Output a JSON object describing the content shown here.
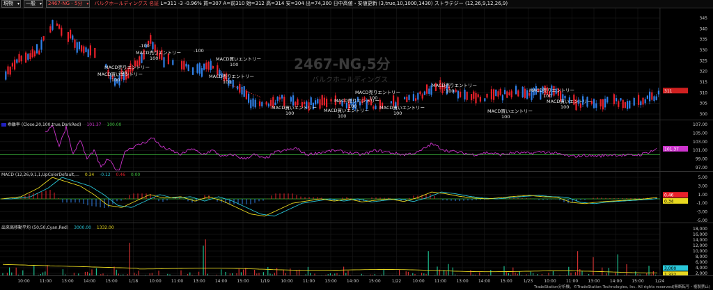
{
  "toolbar": {
    "mode_select": "現物",
    "market_select": "一般",
    "symbol_select": "2467-NG - 5分",
    "company_name": "バルクホールディングス",
    "market_name": "名証",
    "quote_line": "L=311 -3 -0.96% 買=307 A=前310 始=312 高=314 安=304 出=74,300 日中高値・安値更新 (3,true,10,1000,1430) ストラテジー (12,26,9,12,26,9)"
  },
  "watermark": {
    "symbol": "2467-NG,5分",
    "name": "バルクホールディングス"
  },
  "colors": {
    "up": "#e8202a",
    "down": "#2f7fe6",
    "grid": "#1e1e1e",
    "magenta": "#cc33cc",
    "yellow": "#e8d820",
    "cyan": "#29c6d8",
    "green": "#3fbf3f",
    "tag": "#d02020",
    "vol_green": "#1cc090",
    "vol_red": "#d03030"
  },
  "price_pane": {
    "y_ticks": [
      "345",
      "340",
      "335",
      "330",
      "325",
      "320",
      "315",
      "310",
      "305",
      "300"
    ],
    "last_price_tag": "311",
    "annotations": [
      {
        "label": "-100",
        "sub": ""
      },
      {
        "label": "MACD売りエントリー",
        "sub": "100"
      },
      {
        "label": "MACD買いエントリー",
        "sub": "100"
      },
      {
        "label": "-100",
        "sub": ""
      },
      {
        "label": "MACD売りエントリー",
        "sub": "100"
      },
      {
        "label": "MACD買いエントリー",
        "sub": "100"
      },
      {
        "label": "MACD売りエントリー",
        "sub": "100"
      },
      {
        "label": "MACD買いエントリー",
        "sub": "100"
      },
      {
        "label": "MACD売りエントリー",
        "sub": "100"
      },
      {
        "label": "MACD買いエントリー",
        "sub": "100"
      },
      {
        "label": "MACD売りエントリー",
        "sub": "100"
      },
      {
        "label": "MACD買いエントリー",
        "sub": "100"
      },
      {
        "label": "MACD売りエントリー",
        "sub": "100"
      },
      {
        "label": "MACD買いエントリー",
        "sub": "100"
      },
      {
        "label": "MACD売りエントリー",
        "sub": "100"
      },
      {
        "label": "MACD買いエントリー",
        "sub": "100"
      }
    ]
  },
  "deviation_pane": {
    "label": "乖離率 (Close,20,100,true,DarkRed)",
    "value_magenta": "101.37",
    "value_green": "100.00",
    "y_ticks": [
      "107.00",
      "105.00",
      "103.00",
      "101.00",
      "99.00",
      "97.00"
    ],
    "last_tag": "101.37"
  },
  "macd_pane": {
    "label": "MACD (12,26,9,1,1,UpColorDefault,...",
    "value_yellow": "0.34",
    "value_cyan": "-0.12",
    "value_red": "0.46",
    "value_green": "0.00",
    "y_ticks": [
      "5.00",
      "3.00",
      "1.00",
      "-1.00",
      "-3.00",
      "-5.00"
    ],
    "last_tag_1": "0.46",
    "last_tag_2": "0.34"
  },
  "volume_pane": {
    "label": "出来高移動平均 (50,50,Cyan,Red)",
    "value_cyan": "3000.00",
    "value_yellow": "1332.00",
    "y_ticks": [
      "18,000",
      "16,000",
      "14,000",
      "12,000",
      "10,000",
      "8,000",
      "6,000",
      "4,000",
      "2,000"
    ],
    "last_tag_1": "3,000",
    "last_tag_2": "1,332"
  },
  "x_axis": {
    "labels": [
      "10:00",
      "11:00",
      "13:00",
      "14:00",
      "15:00",
      "1/18",
      "10:00",
      "11:00",
      "13:00",
      "14:00",
      "15:00",
      "1/19",
      "10:00",
      "11:00",
      "13:00",
      "14:00",
      "15:00",
      "1/22",
      "10:00",
      "11:00",
      "13:00",
      "14:00",
      "15:00",
      "1/23",
      "10:00",
      "11:00",
      "13:00",
      "14:00",
      "15:00",
      "1/24"
    ]
  },
  "footer": "TradeStation分析機、©TradeStation Technologies, Inc. All rights reserved(無断転写・複製禁止)"
}
